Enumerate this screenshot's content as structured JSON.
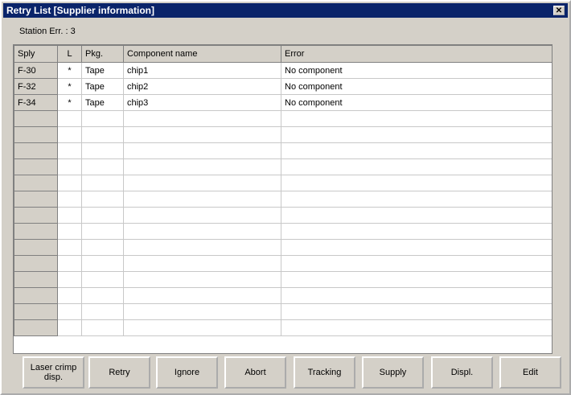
{
  "window": {
    "title": "Retry List [Supplier information]",
    "close_glyph": "✕"
  },
  "station_text": "Station Err. : 3",
  "columns": [
    "Sply",
    "L",
    "Pkg.",
    "Component name",
    "Error"
  ],
  "rows": [
    [
      "F-30",
      "*",
      "Tape",
      "chip1",
      "No component"
    ],
    [
      "F-32",
      "*",
      "Tape",
      "chip2",
      "No component"
    ],
    [
      "F-34",
      "*",
      "Tape",
      "chip3",
      "No component"
    ],
    [
      "",
      "",
      "",
      "",
      ""
    ],
    [
      "",
      "",
      "",
      "",
      ""
    ],
    [
      "",
      "",
      "",
      "",
      ""
    ],
    [
      "",
      "",
      "",
      "",
      ""
    ],
    [
      "",
      "",
      "",
      "",
      ""
    ],
    [
      "",
      "",
      "",
      "",
      ""
    ],
    [
      "",
      "",
      "",
      "",
      ""
    ],
    [
      "",
      "",
      "",
      "",
      ""
    ],
    [
      "",
      "",
      "",
      "",
      ""
    ],
    [
      "",
      "",
      "",
      "",
      ""
    ],
    [
      "",
      "",
      "",
      "",
      ""
    ],
    [
      "",
      "",
      "",
      "",
      ""
    ],
    [
      "",
      "",
      "",
      "",
      ""
    ],
    [
      "",
      "",
      "",
      "",
      ""
    ]
  ],
  "buttons": [
    "Laser crimp disp.",
    "Retry",
    "Ignore",
    "Abort",
    "Tracking",
    "Supply",
    "Displ.",
    "Edit"
  ]
}
